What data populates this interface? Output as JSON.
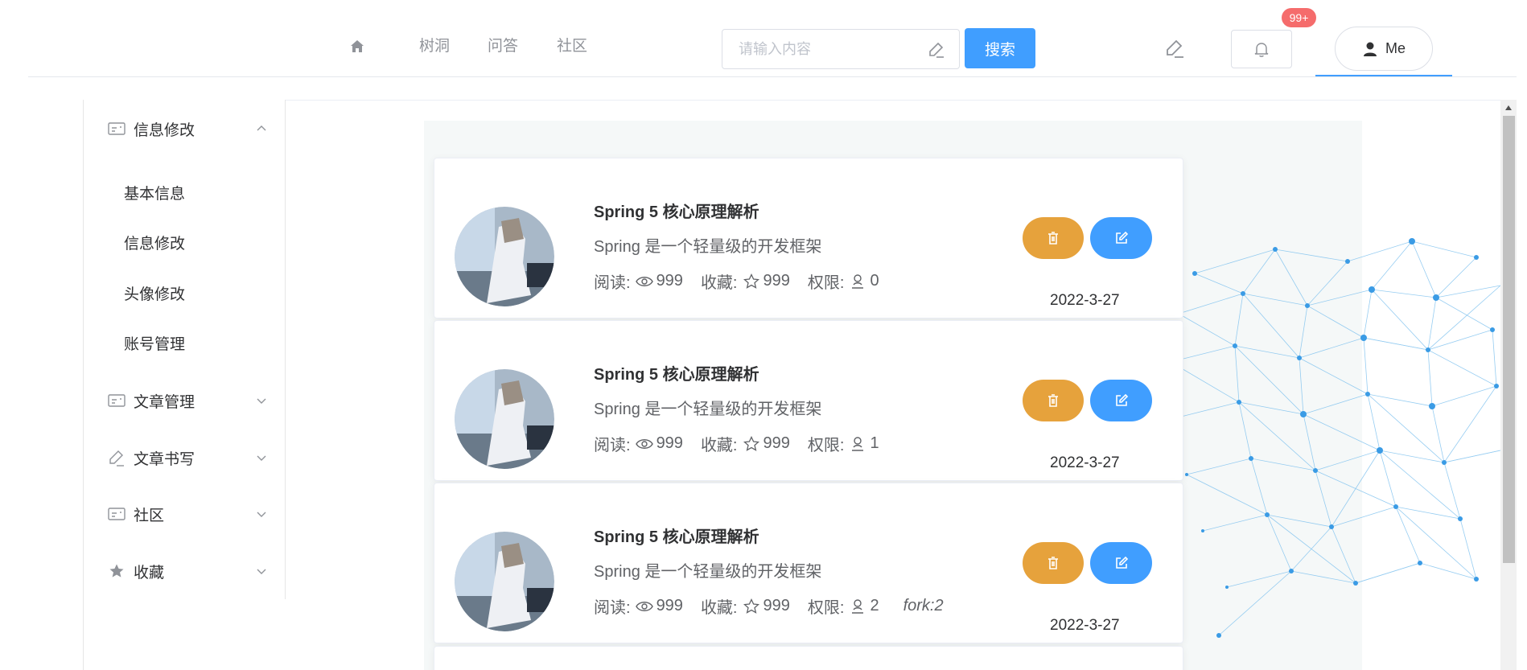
{
  "nav": {
    "home_icon": "home-icon",
    "links": [
      "树洞",
      "问答",
      "社区"
    ]
  },
  "search": {
    "placeholder": "请输入内容",
    "button_label": "搜索"
  },
  "header": {
    "notification_badge": "99+",
    "user_label": "Me"
  },
  "sidebar": {
    "groups": [
      {
        "label": "信息修改",
        "icon": "id-card-icon",
        "expanded": true,
        "items": [
          "基本信息",
          "信息修改",
          "头像修改",
          "账号管理"
        ]
      },
      {
        "label": "文章管理",
        "icon": "id-card-icon",
        "expanded": false
      },
      {
        "label": "文章书写",
        "icon": "edit-pen-icon",
        "expanded": false
      },
      {
        "label": "社区",
        "icon": "id-card-icon",
        "expanded": false
      },
      {
        "label": "收藏",
        "icon": "star-filled-icon",
        "expanded": false
      }
    ]
  },
  "articles": [
    {
      "title": "Spring 5 核心原理解析",
      "description": "Spring 是一个轻量级的开发框架",
      "read_label": "阅读:",
      "reads": "999",
      "fav_label": "收藏:",
      "favorites": "999",
      "perm_label": "权限:",
      "permission": "0",
      "fork": "",
      "date": "2022-3-27"
    },
    {
      "title": "Spring 5 核心原理解析",
      "description": "Spring 是一个轻量级的开发框架",
      "read_label": "阅读:",
      "reads": "999",
      "fav_label": "收藏:",
      "favorites": "999",
      "perm_label": "权限:",
      "permission": "1",
      "fork": "",
      "date": "2022-3-27"
    },
    {
      "title": "Spring 5 核心原理解析",
      "description": "Spring 是一个轻量级的开发框架",
      "read_label": "阅读:",
      "reads": "999",
      "fav_label": "收藏:",
      "favorites": "999",
      "perm_label": "权限:",
      "permission": "2",
      "fork": "fork:2",
      "date": "2022-3-27"
    }
  ],
  "colors": {
    "primary": "#409eff",
    "warning": "#e6a23c",
    "danger": "#f56c6c",
    "text": "#303133",
    "muted": "#909399"
  }
}
